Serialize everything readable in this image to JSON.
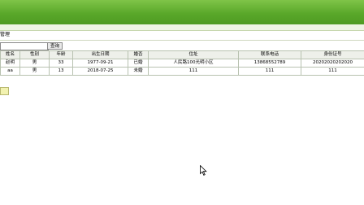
{
  "section": {
    "title": "管理"
  },
  "search": {
    "value": "",
    "placeholder": "",
    "button_label": "查询"
  },
  "table": {
    "columns": [
      "姓名",
      "性别",
      "年龄",
      "出生日期",
      "婚否",
      "住址",
      "联系电话",
      "身份证号"
    ],
    "rows": [
      [
        "赵明",
        "男",
        "33",
        "1977-09-21",
        "已婚",
        "人民路100光明小区",
        "13868552789",
        "20202020202020"
      ],
      [
        "aa",
        "男",
        "13",
        "2018-07-25",
        "未婚",
        "111",
        "111",
        "111"
      ]
    ]
  },
  "colors": {
    "banner": "#5aa82a",
    "header_bg": "#eef0ea",
    "add_button": "#f2f2b0"
  },
  "icons": {
    "cursor": "mouse-pointer-icon"
  }
}
